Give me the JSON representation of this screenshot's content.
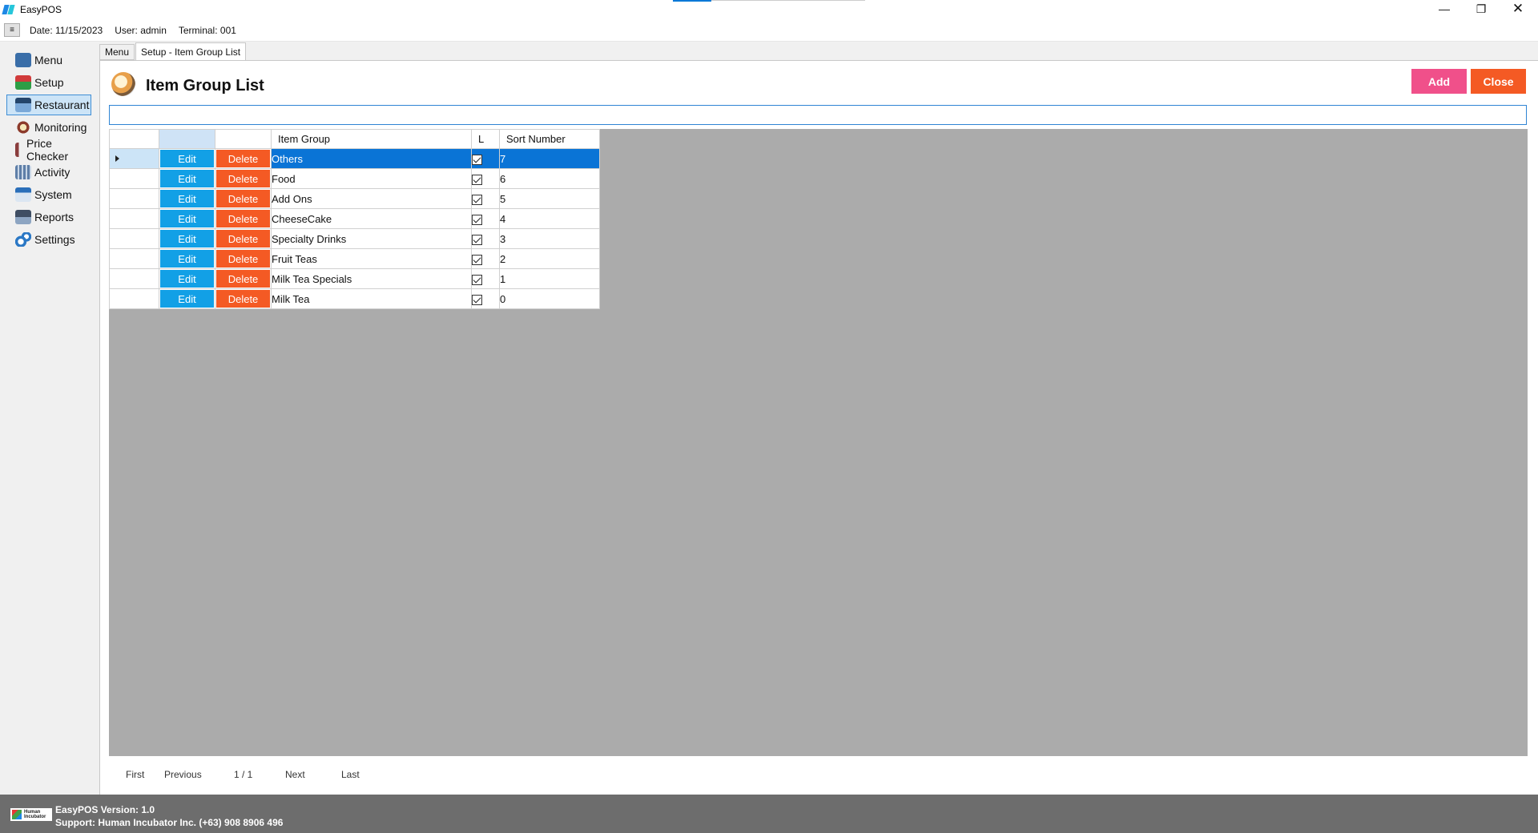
{
  "window": {
    "title": "EasyPOS"
  },
  "infobar": {
    "date": "Date: 11/15/2023",
    "user": "User: admin",
    "terminal": "Terminal: 001",
    "menu_glyph": "≡"
  },
  "sidebar": {
    "items": [
      {
        "label": "Menu",
        "icon": "menu-icon"
      },
      {
        "label": "Setup",
        "icon": "setup-icon"
      },
      {
        "label": "Restaurant",
        "icon": "restaurant-icon",
        "selected": true
      },
      {
        "label": "Monitoring",
        "icon": "monitoring-icon"
      },
      {
        "label": "Price Checker",
        "icon": "price-checker-icon"
      },
      {
        "label": "Activity",
        "icon": "activity-icon"
      },
      {
        "label": "System",
        "icon": "system-icon"
      },
      {
        "label": "Reports",
        "icon": "reports-icon"
      },
      {
        "label": "Settings",
        "icon": "settings-icon"
      }
    ]
  },
  "tabs": [
    {
      "label": "Menu"
    },
    {
      "label": "Setup - Item Group List",
      "active": true
    }
  ],
  "page": {
    "title": "Item Group List",
    "add_label": "Add",
    "close_label": "Close",
    "search_value": ""
  },
  "grid": {
    "columns": [
      "",
      "",
      "",
      "Item Group",
      "L",
      "Sort Number"
    ],
    "edit_label": "Edit",
    "delete_label": "Delete",
    "rows": [
      {
        "item_group": "Others",
        "locked": true,
        "sort_number": "7",
        "selected": true
      },
      {
        "item_group": "Food",
        "locked": true,
        "sort_number": "6"
      },
      {
        "item_group": "Add Ons",
        "locked": true,
        "sort_number": "5"
      },
      {
        "item_group": "CheeseCake",
        "locked": true,
        "sort_number": "4"
      },
      {
        "item_group": "Specialty Drinks",
        "locked": true,
        "sort_number": "3"
      },
      {
        "item_group": "Fruit Teas",
        "locked": true,
        "sort_number": "2"
      },
      {
        "item_group": "Milk Tea Specials",
        "locked": true,
        "sort_number": "1"
      },
      {
        "item_group": "Milk Tea",
        "locked": true,
        "sort_number": "0"
      }
    ]
  },
  "pager": {
    "first": "First",
    "previous": "Previous",
    "page": "1 / 1",
    "next": "Next",
    "last": "Last"
  },
  "footer": {
    "version": "EasyPOS Version: 1.0",
    "support": "Support: Human Incubator Inc. (+63) 908 8906 496",
    "logo_text": "Human Incubator"
  },
  "colors": {
    "add": "#f0508a",
    "close": "#f45a24",
    "edit": "#12a0e6",
    "delete": "#f45a24",
    "selection": "#0a74d6"
  }
}
